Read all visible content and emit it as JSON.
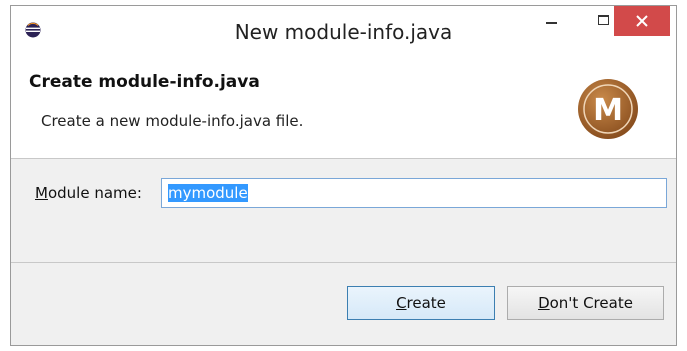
{
  "window": {
    "title": "New module-info.java"
  },
  "banner": {
    "title": "Create module-info.java",
    "description": "Create a new module-info.java file.",
    "logo_letter": "M"
  },
  "form": {
    "module_label_mnemonic": "M",
    "module_label_rest": "odule name:",
    "module_value": "mymodule"
  },
  "buttons": {
    "create_mnemonic": "C",
    "create_rest": "reate",
    "dont_create_mnemonic": "D",
    "dont_create_rest": "on't Create"
  },
  "icons": {
    "app": "eclipse-icon",
    "logo": "module-m-icon",
    "minimize": "minimize-icon",
    "maximize": "maximize-icon",
    "close": "close-icon"
  },
  "colors": {
    "close_button": "#d24a4a",
    "selection": "#3399ff",
    "logo_brown": "#a0602a",
    "default_button_border": "#3c7fb1"
  }
}
